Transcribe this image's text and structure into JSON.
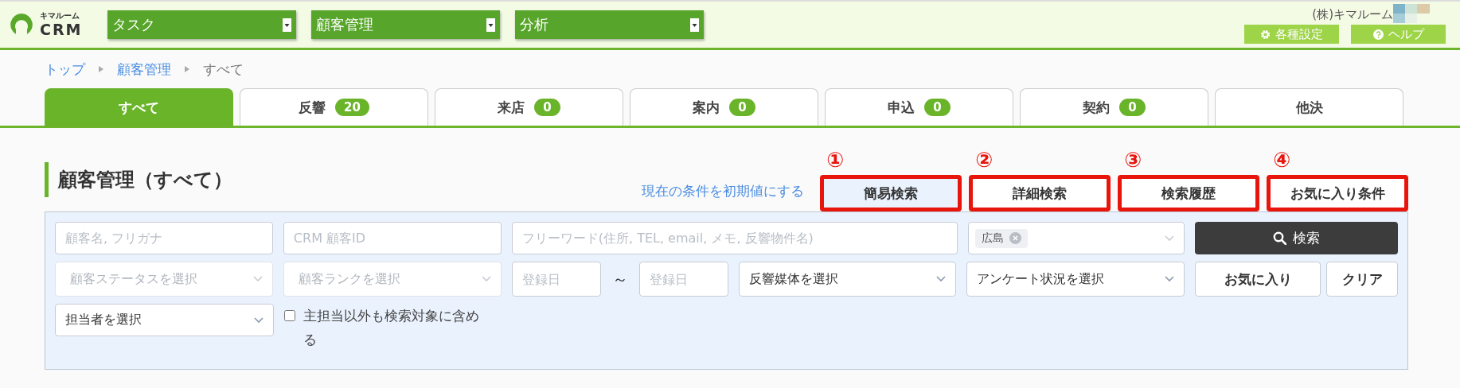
{
  "header": {
    "logo_small": "キマルーム",
    "logo_text": "CRM",
    "menus": [
      {
        "label": "タスク"
      },
      {
        "label": "顧客管理"
      },
      {
        "label": "分析"
      }
    ],
    "company": "(株)キマルーム",
    "buttons": [
      {
        "label": "各種設定",
        "kind": "settings"
      },
      {
        "label": "ヘルプ",
        "kind": "help"
      }
    ]
  },
  "breadcrumb": [
    {
      "label": "トップ",
      "link": true
    },
    {
      "label": "顧客管理",
      "link": true
    },
    {
      "label": "すべて",
      "link": false
    }
  ],
  "tabs": [
    {
      "label": "すべて",
      "selected": true
    },
    {
      "label": "反響",
      "badge": "20",
      "selected": false
    },
    {
      "label": "来店",
      "badge": "0",
      "selected": false
    },
    {
      "label": "案内",
      "badge": "0",
      "selected": false
    },
    {
      "label": "申込",
      "badge": "0",
      "selected": false
    },
    {
      "label": "契約",
      "badge": "0",
      "selected": false
    },
    {
      "label": "他決",
      "selected": false
    }
  ],
  "page_title": "顧客管理（すべて）",
  "reset_link": "現在の条件を初期値にする",
  "search_modes": [
    {
      "label": "簡易検索",
      "number": "①",
      "selected": true,
      "highlighted": true
    },
    {
      "label": "詳細検索",
      "number": "②",
      "selected": false,
      "highlighted": true
    },
    {
      "label": "検索履歴",
      "number": "③",
      "selected": false,
      "highlighted": true
    },
    {
      "label": "お気に入り条件",
      "number": "④",
      "selected": false,
      "highlighted": true
    }
  ],
  "search_panel": {
    "rows": [
      {
        "fields": [
          {
            "kind": "input",
            "placeholder": "顧客名, フリガナ"
          },
          {
            "kind": "input",
            "placeholder": "CRM 顧客ID"
          },
          {
            "kind": "input",
            "placeholder": "フリーワード(住所, TEL, email, メモ, 反響物件名)"
          },
          {
            "kind": "tags",
            "tags": [
              "広島"
            ]
          },
          {
            "kind": "search_button",
            "label": "検索"
          }
        ]
      },
      {
        "fields": [
          {
            "kind": "select",
            "placeholder": "顧客ステータスを選択",
            "disabled": true
          },
          {
            "kind": "select",
            "placeholder": "顧客ランクを選択",
            "disabled": true
          },
          {
            "kind": "daterange",
            "from_placeholder": "登録日",
            "separator": "～",
            "to_placeholder": "登録日"
          },
          {
            "kind": "select",
            "placeholder": "反響媒体を選択",
            "disabled": false
          },
          {
            "kind": "select",
            "placeholder": "アンケート状況を選択",
            "disabled": false
          },
          {
            "kind": "button",
            "label": "お気に入り"
          },
          {
            "kind": "button",
            "label": "クリア"
          }
        ]
      },
      {
        "fields": [
          {
            "kind": "select",
            "placeholder": "担当者を選択",
            "disabled": false
          },
          {
            "kind": "checkbox",
            "label": "主担当以外も検索対象に含める",
            "checked": false
          }
        ]
      }
    ]
  }
}
